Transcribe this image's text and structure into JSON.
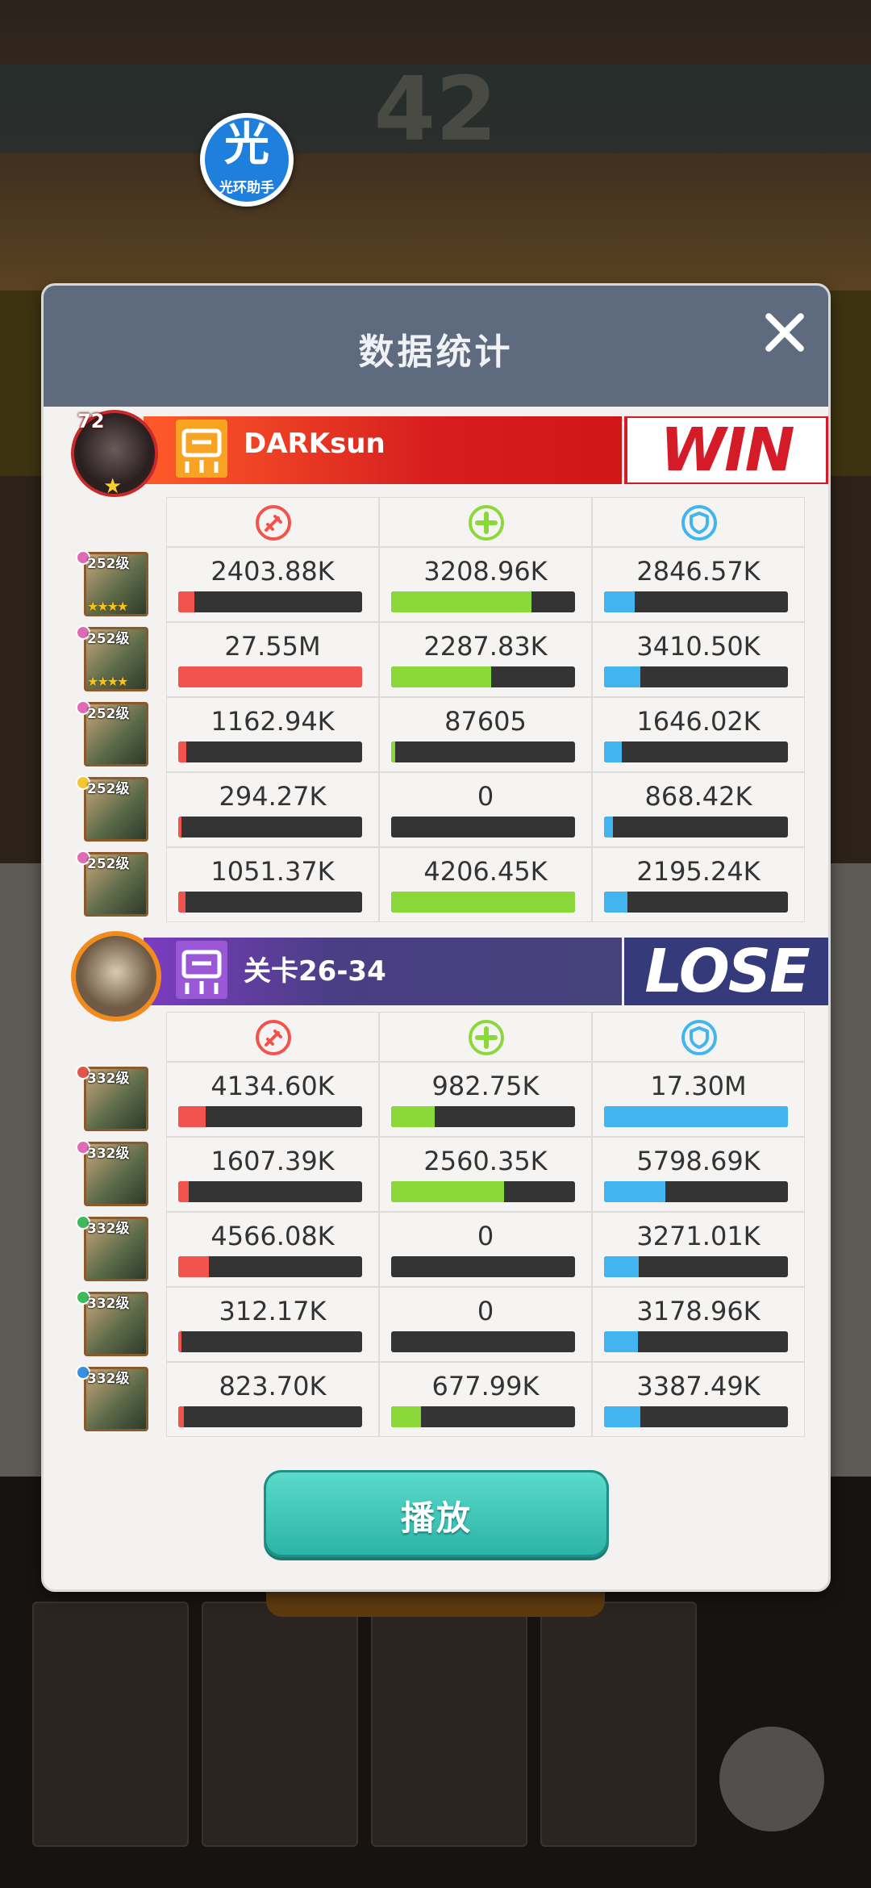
{
  "assistant": {
    "label": "光环助手",
    "glyph": "光"
  },
  "dialog": {
    "title": "数据统计",
    "play_label": "播放"
  },
  "colors": {
    "damage": "#f2534c",
    "heal": "#8ad83a",
    "defense": "#42b4ef",
    "win": "#d41b27",
    "lose": "#353b7a"
  },
  "teams": [
    {
      "name": "DARKsun",
      "result": "WIN",
      "level": "72",
      "stat_icons": [
        "sword-icon",
        "heal-cross-icon",
        "shield-icon"
      ],
      "heroes": [
        {
          "level": "252级",
          "gem": "#e06bb5",
          "stars": "★★★★",
          "damage": "2403.88K",
          "heal": "3208.96K",
          "defense": "2846.57K",
          "damage_pct": 0.087,
          "heal_pct": 0.763,
          "defense_pct": 0.165
        },
        {
          "level": "252级",
          "gem": "#e06bb5",
          "stars": "★★★★",
          "damage": "27.55M",
          "heal": "2287.83K",
          "defense": "3410.50K",
          "damage_pct": 1.0,
          "heal_pct": 0.544,
          "defense_pct": 0.197
        },
        {
          "level": "252级",
          "gem": "#e06bb5",
          "stars": "",
          "damage": "1162.94K",
          "heal": "87605",
          "defense": "1646.02K",
          "damage_pct": 0.042,
          "heal_pct": 0.021,
          "defense_pct": 0.095
        },
        {
          "level": "252级",
          "gem": "#f2c531",
          "stars": "",
          "damage": "294.27K",
          "heal": "0",
          "defense": "868.42K",
          "damage_pct": 0.011,
          "heal_pct": 0.0,
          "defense_pct": 0.05
        },
        {
          "level": "252级",
          "gem": "#e06bb5",
          "stars": "",
          "damage": "1051.37K",
          "heal": "4206.45K",
          "defense": "2195.24K",
          "damage_pct": 0.038,
          "heal_pct": 1.0,
          "defense_pct": 0.127
        }
      ]
    },
    {
      "name": "关卡26-34",
      "result": "LOSE",
      "stat_icons": [
        "sword-icon",
        "heal-cross-icon",
        "shield-icon"
      ],
      "heroes": [
        {
          "level": "332级",
          "gem": "#e0564a",
          "stars": "",
          "damage": "4134.60K",
          "heal": "982.75K",
          "defense": "17.30M",
          "damage_pct": 0.15,
          "heal_pct": 0.235,
          "defense_pct": 1.0
        },
        {
          "level": "332级",
          "gem": "#e06bb5",
          "stars": "",
          "damage": "1607.39K",
          "heal": "2560.35K",
          "defense": "5798.69K",
          "damage_pct": 0.058,
          "heal_pct": 0.612,
          "defense_pct": 0.335
        },
        {
          "level": "332级",
          "gem": "#3dba5a",
          "stars": "",
          "damage": "4566.08K",
          "heal": "0",
          "defense": "3271.01K",
          "damage_pct": 0.166,
          "heal_pct": 0.0,
          "defense_pct": 0.189
        },
        {
          "level": "332级",
          "gem": "#3dba5a",
          "stars": "",
          "damage": "312.17K",
          "heal": "0",
          "defense": "3178.96K",
          "damage_pct": 0.011,
          "heal_pct": 0.0,
          "defense_pct": 0.184
        },
        {
          "level": "332级",
          "gem": "#3a8ee0",
          "stars": "",
          "damage": "823.70K",
          "heal": "677.99K",
          "defense": "3387.49K",
          "damage_pct": 0.03,
          "heal_pct": 0.162,
          "defense_pct": 0.196
        }
      ]
    }
  ]
}
